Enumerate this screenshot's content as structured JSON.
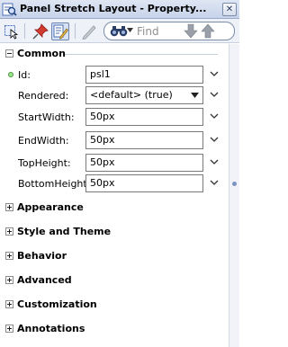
{
  "window": {
    "title": "Panel Stretch Layout - Property...",
    "close_glyph": "✕"
  },
  "toolbar": {
    "find_placeholder": "Find"
  },
  "sections": {
    "common": {
      "label": "Common",
      "expanded": true,
      "properties": [
        {
          "label": "Id:",
          "value": "psl1",
          "required": true
        },
        {
          "label": "Rendered:",
          "value": "<default> (true)"
        },
        {
          "label": "StartWidth:",
          "value": "50px"
        },
        {
          "label": "EndWidth:",
          "value": "50px"
        },
        {
          "label": "TopHeight:",
          "value": "50px"
        },
        {
          "label": "BottomHeight:",
          "value": "50px"
        }
      ]
    },
    "collapsed": [
      {
        "label": "Appearance"
      },
      {
        "label": "Style and Theme"
      },
      {
        "label": "Behavior"
      },
      {
        "label": "Advanced"
      },
      {
        "label": "Customization"
      },
      {
        "label": "Annotations"
      }
    ]
  },
  "colors": {
    "accent": "#4a6fb5",
    "required_dot": "#9be38d",
    "pin_red": "#d23a2f"
  }
}
